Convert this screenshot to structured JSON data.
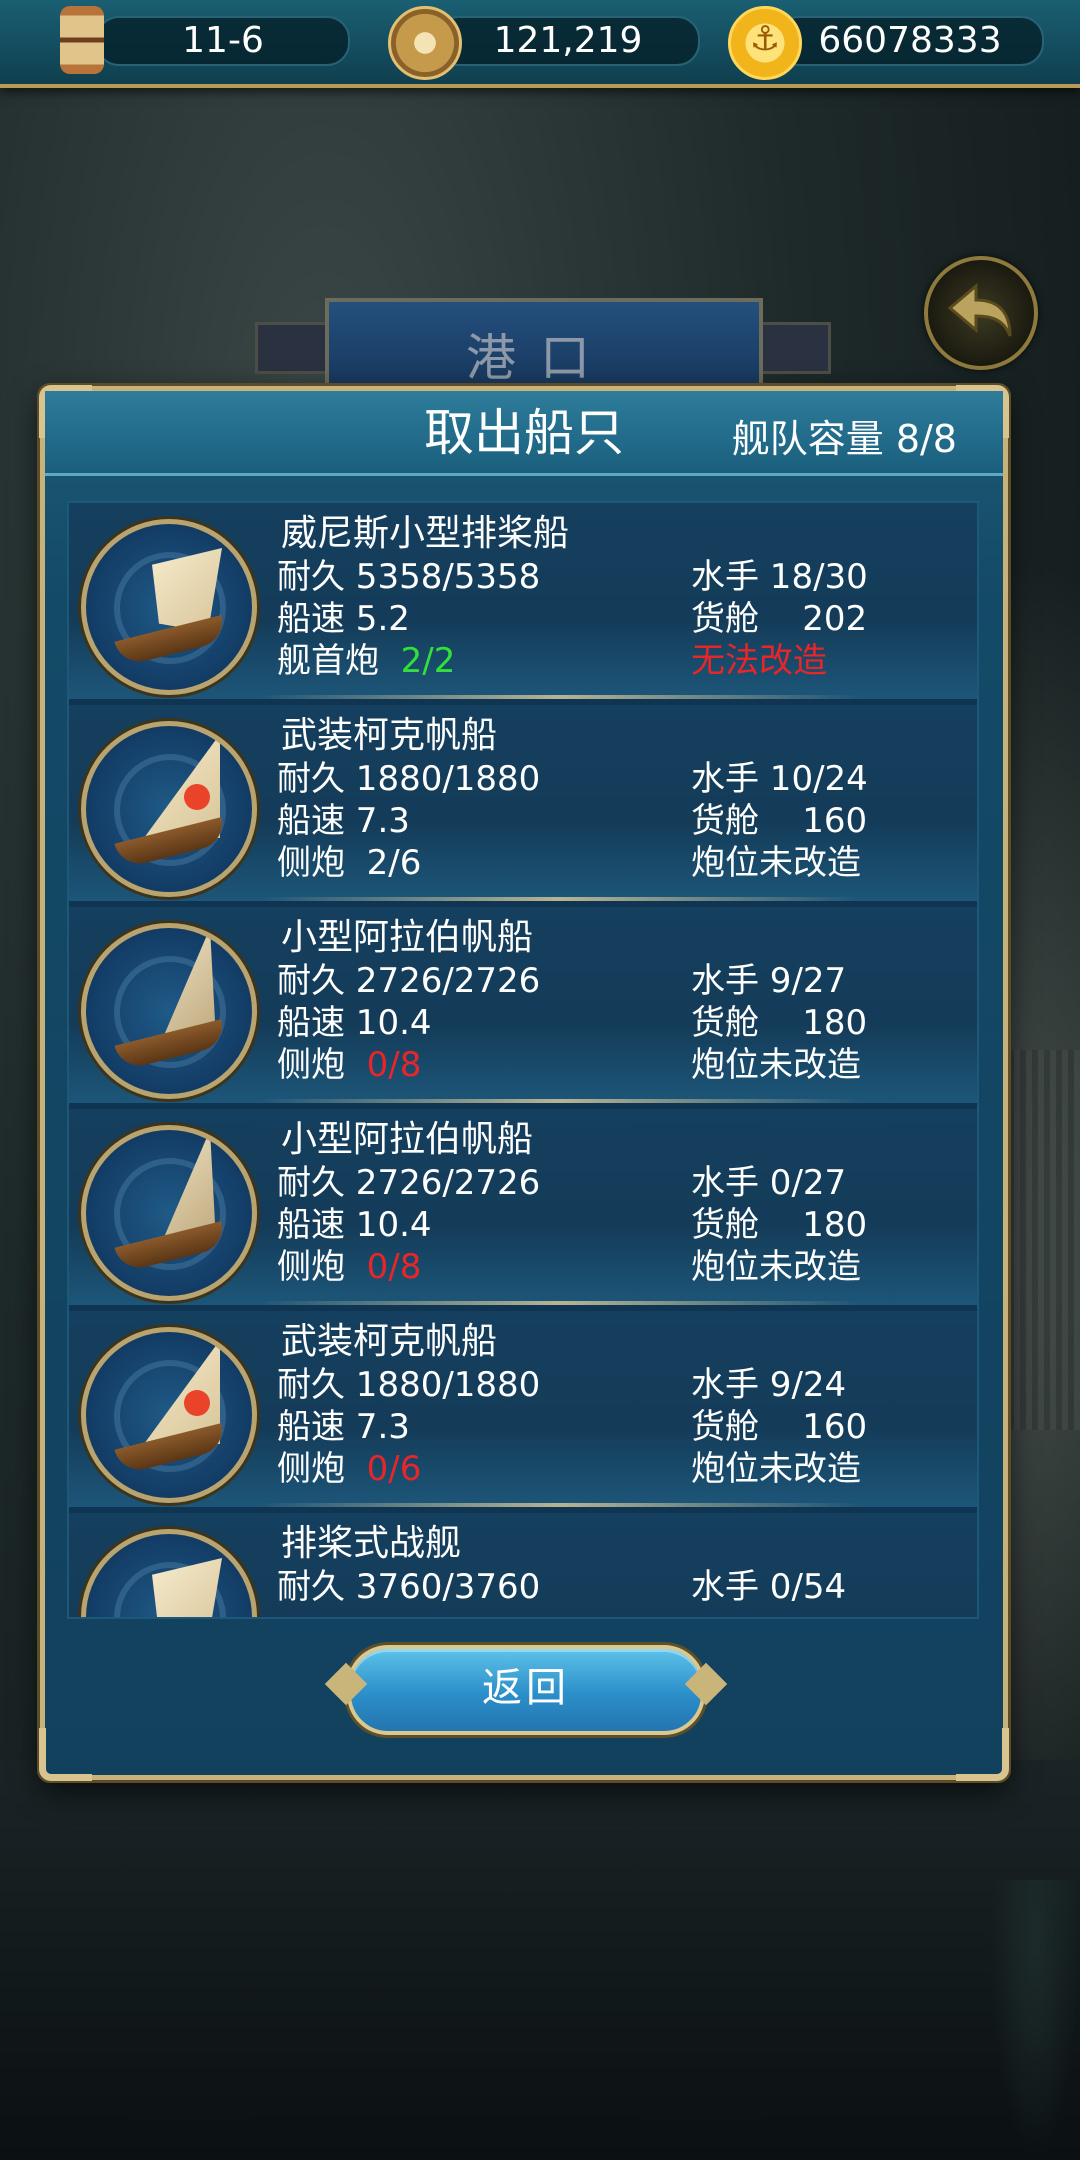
{
  "topbar": {
    "time_value": "11-6",
    "reputation_value": "121,219",
    "gold_value": "66078333"
  },
  "port_title": "港口",
  "dialog": {
    "title": "取出船只",
    "fleet_capacity": "舰队容量 8/8",
    "return_label": "返回"
  },
  "ships": [
    {
      "name": "威尼斯小型排桨船",
      "durability": "耐久 5358/5358",
      "sailors": "水手 18/30",
      "speed": "船速 5.2",
      "cargo": "货舱    202",
      "cannon_label": "舰首炮",
      "cannon_value": "2/2",
      "cannon_color": "#31e13a",
      "mod_status": "无法改造",
      "mod_color": "#e8262a",
      "icon": "galley-ship-icon"
    },
    {
      "name": "武装柯克帆船",
      "durability": "耐久 1880/1880",
      "sailors": "水手 10/24",
      "speed": "船速 7.3",
      "cargo": "货舱    160",
      "cannon_label": "侧炮",
      "cannon_value": "2/6",
      "cannon_color": "#ffffff",
      "mod_status": "炮位未改造",
      "mod_color": "#ffffff",
      "icon": "cog-ship-icon"
    },
    {
      "name": "小型阿拉伯帆船",
      "durability": "耐久 2726/2726",
      "sailors": "水手 9/27",
      "speed": "船速 10.4",
      "cargo": "货舱    180",
      "cannon_label": "侧炮",
      "cannon_value": "0/8",
      "cannon_color": "#e8262a",
      "mod_status": "炮位未改造",
      "mod_color": "#ffffff",
      "icon": "dhow-ship-icon"
    },
    {
      "name": "小型阿拉伯帆船",
      "durability": "耐久 2726/2726",
      "sailors": "水手 0/27",
      "speed": "船速 10.4",
      "cargo": "货舱    180",
      "cannon_label": "侧炮",
      "cannon_value": "0/8",
      "cannon_color": "#e8262a",
      "mod_status": "炮位未改造",
      "mod_color": "#ffffff",
      "icon": "dhow-ship-icon"
    },
    {
      "name": "武装柯克帆船",
      "durability": "耐久 1880/1880",
      "sailors": "水手 9/24",
      "speed": "船速 7.3",
      "cargo": "货舱    160",
      "cannon_label": "侧炮",
      "cannon_value": "0/6",
      "cannon_color": "#e8262a",
      "mod_status": "炮位未改造",
      "mod_color": "#ffffff",
      "icon": "cog-ship-icon"
    },
    {
      "name": "排桨式战舰",
      "durability": "耐久 3760/3760",
      "sailors": "水手 0/54",
      "icon": "galley-ship-icon"
    }
  ]
}
